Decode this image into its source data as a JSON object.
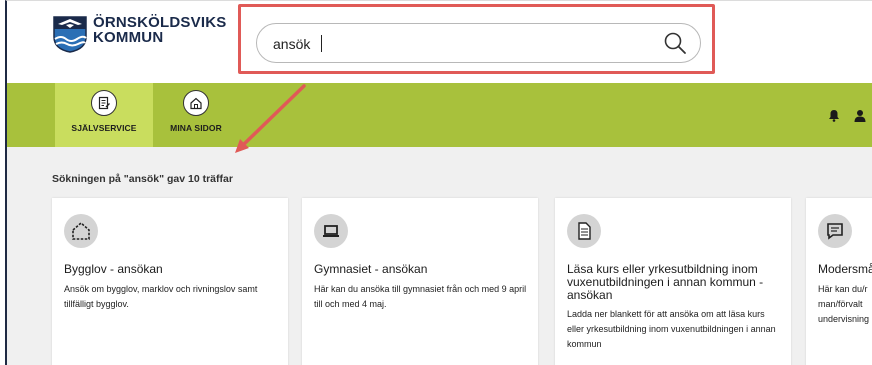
{
  "logo": {
    "line1": "ÖRNSKÖLDSVIKS",
    "line2": "KOMMUN"
  },
  "search": {
    "value": "ansök",
    "placeholder": ""
  },
  "nav": {
    "items": [
      {
        "label": "SJÄLVSERVICE",
        "icon": "edit-document-icon",
        "active": true
      },
      {
        "label": "MINA SIDOR",
        "icon": "home-icon",
        "active": false
      }
    ],
    "right_icons": [
      "bell-icon",
      "user-icon"
    ]
  },
  "results": {
    "summary": "Sökningen på \"ansök\" gav 10 träffar",
    "cards": [
      {
        "icon": "house-outline-icon",
        "title": "Bygglov - ansökan",
        "description": "Ansök om bygglov, marklov och rivningslov samt tillfälligt bygglov."
      },
      {
        "icon": "laptop-icon",
        "title": "Gymnasiet - ansökan",
        "description": "Här kan du ansöka till gymnasiet från och med 9 april till och med 4 maj."
      },
      {
        "icon": "document-icon",
        "title": "Läsa kurs eller yrkesutbildning inom vuxenutbildningen i annan kommun - ansökan",
        "description": "Ladda ner blankett för att ansöka om att läsa kurs eller yrkesutbildning inom vuxenutbildningen i annan kommun"
      },
      {
        "icon": "chat-icon",
        "title": "Modersmå",
        "description": "Här kan du/r man/förvalt undervisning"
      }
    ]
  },
  "colors": {
    "accent_green": "#a8c13c",
    "active_green": "#c9dd5e",
    "annotation_red": "#e05a57",
    "logo_navy": "#1a2a4a"
  }
}
